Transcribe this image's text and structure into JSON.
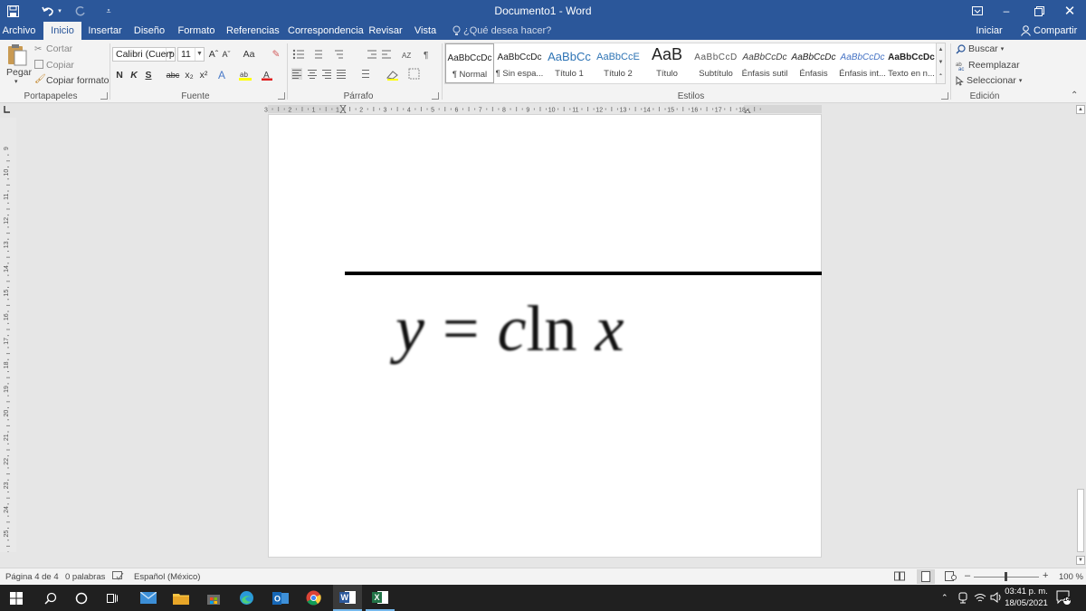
{
  "window": {
    "title": "Documento1 - Word",
    "sign_in": "Iniciar sesión",
    "share": "Compartir"
  },
  "tabs": [
    "Archivo",
    "Inicio",
    "Insertar",
    "Diseño",
    "Formato",
    "Referencias",
    "Correspondencia",
    "Revisar",
    "Vista"
  ],
  "tell_me": "¿Qué desea hacer?",
  "clipboard": {
    "paste": "Pegar",
    "cut": "Cortar",
    "copy": "Copiar",
    "format_painter": "Copiar formato",
    "group": "Portapapeles"
  },
  "font": {
    "name": "Calibri (Cuerpo",
    "size": "11",
    "grow": "Aˆ",
    "shrink": "Aˇ",
    "case": "Aa",
    "bold": "N",
    "italic": "K",
    "underline": "S",
    "strike": "abc",
    "subscript": "x₂",
    "superscript": "x²",
    "group": "Fuente"
  },
  "paragraph": {
    "group": "Párrafo"
  },
  "styles": {
    "items": [
      {
        "preview": "AaBbCcDc",
        "name": "¶ Normal"
      },
      {
        "preview": "AaBbCcDc",
        "name": "¶ Sin espa..."
      },
      {
        "preview": "AaBbCc",
        "name": "Título 1"
      },
      {
        "preview": "AaBbCcE",
        "name": "Título 2"
      },
      {
        "preview": "AaB",
        "name": "Título"
      },
      {
        "preview": "AaBbCcD",
        "name": "Subtítulo"
      },
      {
        "preview": "AaBbCcDc",
        "name": "Énfasis sutil"
      },
      {
        "preview": "AaBbCcDc",
        "name": "Énfasis"
      },
      {
        "preview": "AaBbCcDc",
        "name": "Énfasis int..."
      },
      {
        "preview": "AaBbCcDc",
        "name": "Texto en n..."
      }
    ],
    "group": "Estilos"
  },
  "editing": {
    "find": "Buscar",
    "replace": "Reemplazar",
    "select": "Seleccionar",
    "group": "Edición"
  },
  "ruler_numbers": [
    "3",
    "2",
    "1",
    "1",
    "2",
    "3",
    "4",
    "5",
    "6",
    "7",
    "8",
    "9",
    "10",
    "11",
    "12",
    "13",
    "14",
    "15",
    "16",
    "17",
    "18"
  ],
  "vruler_numbers": [
    "9",
    "10",
    "11",
    "12",
    "13",
    "14",
    "15",
    "16",
    "17",
    "18",
    "19",
    "20",
    "21",
    "22",
    "23",
    "24",
    "25"
  ],
  "document": {
    "equation_y": "y",
    "equation_eq": "=",
    "equation_c": "c",
    "equation_ln": "ln",
    "equation_x": "x"
  },
  "status": {
    "page": "Página 4 de 4",
    "words": "0 palabras",
    "language": "Español (México)",
    "zoom": "100 %"
  },
  "taskbar": {
    "time": "03:41 p. m.",
    "date": "18/05/2021",
    "notifications": "14"
  },
  "colors": {
    "word_blue": "#2b579a",
    "ribbon_bg": "#f3f3f3",
    "taskbar_bg": "#202020"
  }
}
